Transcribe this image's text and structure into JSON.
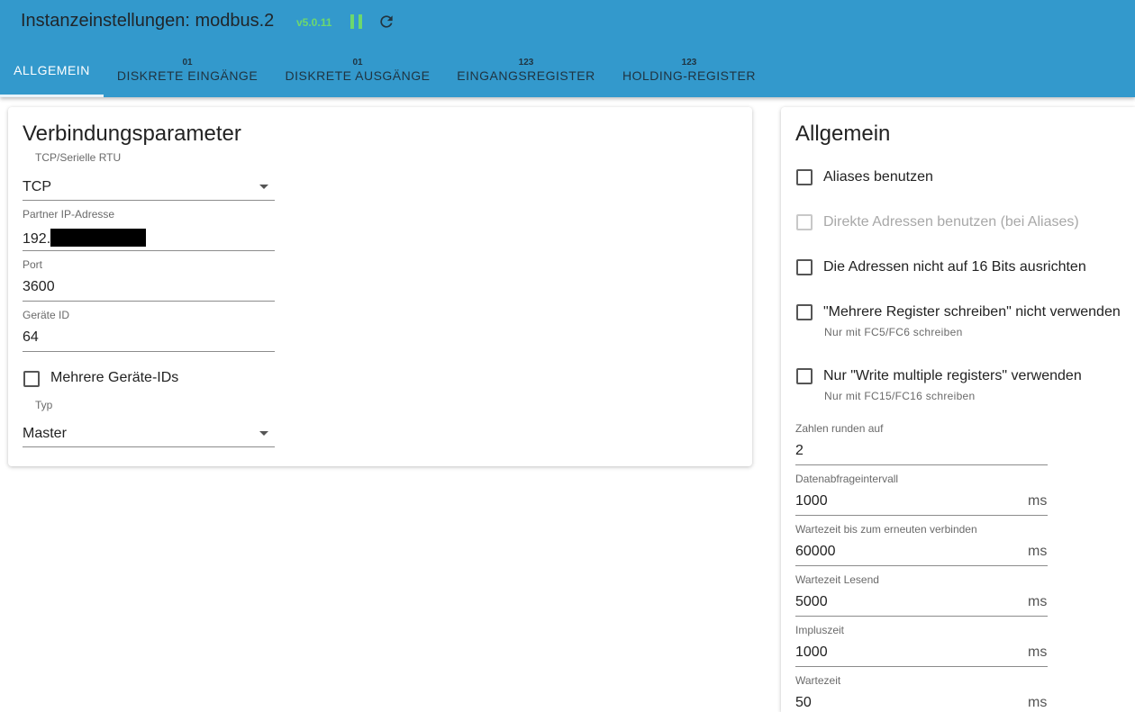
{
  "header": {
    "title": "Instanzeinstellungen: modbus.2",
    "version": "v5.0.11",
    "icons": {
      "pause": "pause-icon",
      "reload": "reload-icon"
    }
  },
  "tabs": [
    {
      "sup": "",
      "label": "ALLGEMEIN"
    },
    {
      "sup": "01",
      "label": "DISKRETE EINGÄNGE"
    },
    {
      "sup": "01",
      "label": "DISKRETE AUSGÄNGE"
    },
    {
      "sup": "123",
      "label": "EINGANGSREGISTER"
    },
    {
      "sup": "123",
      "label": "HOLDING-REGISTER"
    }
  ],
  "connection": {
    "title": "Verbindungsparameter",
    "type_label": "TCP/Serielle RTU",
    "type_value": "TCP",
    "ip_label": "Partner IP-Adresse",
    "ip_value": "192.",
    "port_label": "Port",
    "port_value": "3600",
    "device_id_label": "Geräte ID",
    "device_id_value": "64",
    "multi_ids_label": "Mehrere Geräte-IDs",
    "mode_label": "Typ",
    "mode_value": "Master"
  },
  "general": {
    "title": "Allgemein",
    "checkboxes": [
      {
        "label": "Aliases benutzen",
        "help": ""
      },
      {
        "label": "Direkte Adressen benutzen (bei Aliases)",
        "help": ""
      },
      {
        "label": "Die Adressen nicht auf 16 Bits ausrichten",
        "help": ""
      },
      {
        "label": "\"Mehrere Register schreiben\" nicht verwenden",
        "help": "Nur mit FC5/FC6 schreiben"
      },
      {
        "label": "Nur \"Write multiple registers\" verwenden",
        "help": "Nur mit FC15/FC16 schreiben"
      }
    ],
    "fields": [
      {
        "label": "Zahlen runden auf",
        "value": "2",
        "unit": ""
      },
      {
        "label": "Datenabfrageintervall",
        "value": "1000",
        "unit": "ms"
      },
      {
        "label": "Wartezeit bis zum erneuten verbinden",
        "value": "60000",
        "unit": "ms"
      },
      {
        "label": "Wartezeit Lesend",
        "value": "5000",
        "unit": "ms"
      },
      {
        "label": "Impluszeit",
        "value": "1000",
        "unit": "ms"
      },
      {
        "label": "Wartezeit",
        "value": "50",
        "unit": "ms"
      }
    ]
  },
  "colors": {
    "header_bg": "#3399cc",
    "version": "#6dd86d",
    "pause": "#6dd86d"
  }
}
